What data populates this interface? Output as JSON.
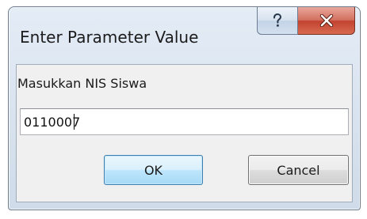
{
  "dialog": {
    "title": "Enter Parameter Value",
    "help_icon": "question-mark-icon",
    "close_icon": "close-x-icon",
    "prompt": "Masukkan NIS Siswa",
    "input_value": "0110007",
    "ok_label": "OK",
    "cancel_label": "Cancel"
  },
  "colors": {
    "title_gradient_top": "#e4ecf6",
    "client_background": "#f0f0f0",
    "close_button_red": "#c24331",
    "ok_button_border": "#3c7fb1"
  }
}
